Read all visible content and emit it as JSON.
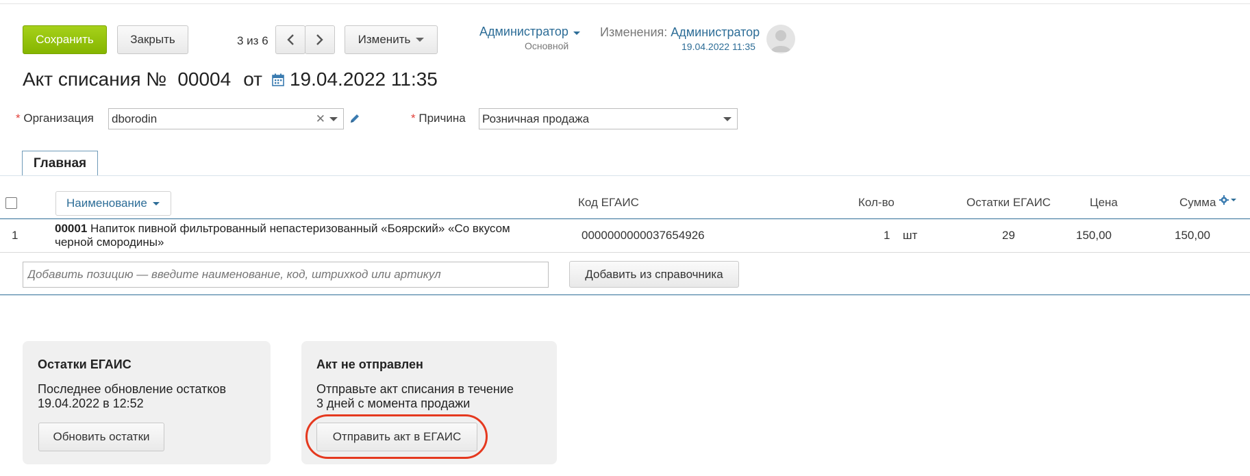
{
  "toolbar": {
    "save_label": "Сохранить",
    "close_label": "Закрыть",
    "pager": "3 из 6",
    "change_label": "Изменить"
  },
  "user": {
    "name": "Администратор",
    "role": "Основной",
    "changes_label": "Изменения:",
    "changes_user": "Администратор",
    "changes_date": "19.04.2022 11:35"
  },
  "document": {
    "title_prefix": "Акт списания №",
    "number": "00004",
    "from_label": "от",
    "date": "19.04.2022 11:35"
  },
  "form": {
    "org_label": "Организация",
    "org_value": "dborodin",
    "reason_label": "Причина",
    "reason_value": "Розничная продажа",
    "required_mark": "*"
  },
  "tabs": [
    {
      "label": "Главная"
    }
  ],
  "table": {
    "headers": {
      "name": "Наименование",
      "egais_code": "Код ЕГАИС",
      "qty": "Кол-во",
      "egais_rest": "Остатки ЕГАИС",
      "price": "Цена",
      "sum": "Сумма"
    },
    "rows": [
      {
        "index": "1",
        "code": "00001",
        "name": "Напиток пивной фильтрованный непастеризованный «Боярский» «Со вкусом черной смородины»",
        "egais_code": "0000000000037654926",
        "qty": "1",
        "unit": "шт",
        "egais_rest": "29",
        "price": "150,00",
        "sum": "150,00"
      }
    ],
    "add_placeholder": "Добавить позицию — введите наименование, код, штрихкод или артикул",
    "add_from_catalog": "Добавить из справочника"
  },
  "cards": {
    "rests": {
      "title": "Остатки ЕГАИС",
      "text_line1": "Последнее обновление остатков",
      "text_line2": "19.04.2022 в 12:52",
      "button": "Обновить остатки"
    },
    "act": {
      "title": "Акт не отправлен",
      "text_line1": "Отправьте акт списания в течение",
      "text_line2": "3 дней с момента продажи",
      "button": "Отправить акт в ЕГАИС"
    }
  },
  "colors": {
    "accent": "#2d6d97",
    "save_green": "#8dbf00",
    "highlight_circle": "#e5391f"
  }
}
